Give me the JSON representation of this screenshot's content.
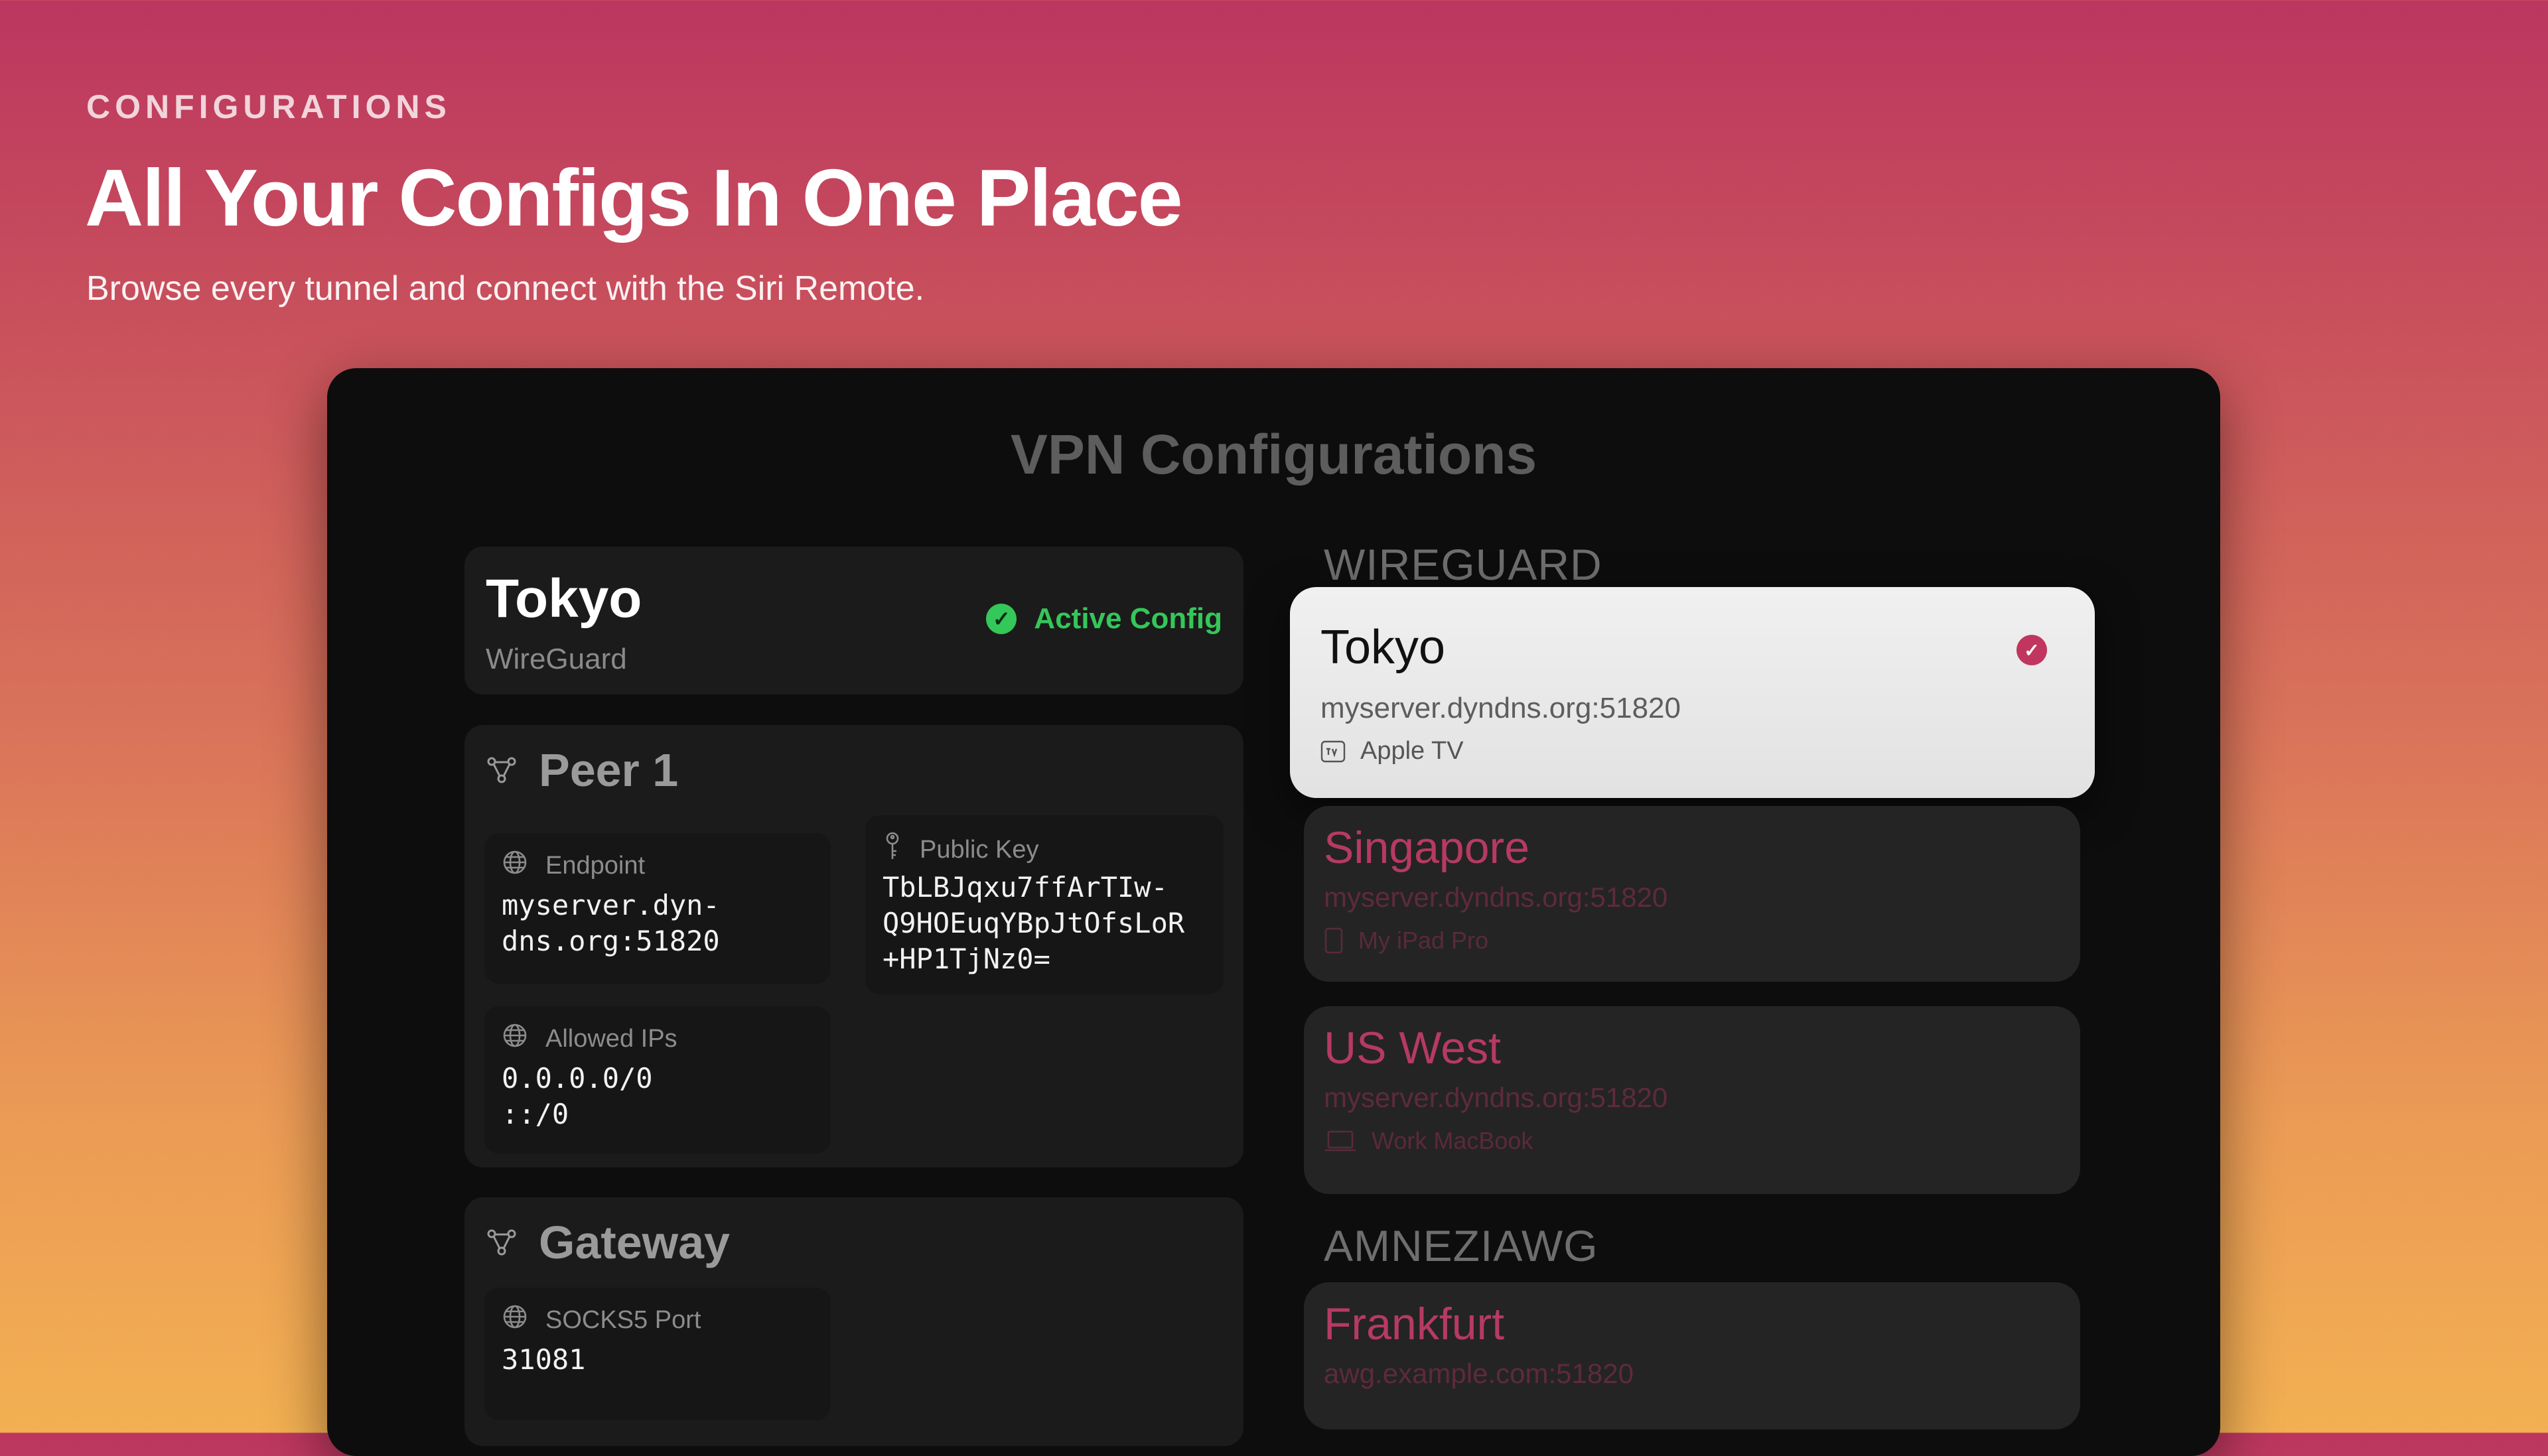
{
  "page": {
    "eyebrow": "CONFIGURATIONS",
    "headline": "All Your Configs In One Place",
    "subline": "Browse every tunnel and connect with the Siri Remote."
  },
  "screen": {
    "title": "VPN Configurations",
    "detail": {
      "name": "Tokyo",
      "protocol": "WireGuard",
      "status_label": "Active Config",
      "peer": {
        "title": "Peer 1",
        "endpoint_label": "Endpoint",
        "endpoint_value": "myserver.dyn-\ndns.org:51820",
        "public_key_label": "Public Key",
        "public_key_value": "TbLBJqxu7ffArTIw-\nQ9HOEuqYBpJtOfsLoR\n+HP1TjNz0=",
        "allowed_ips_label": "Allowed IPs",
        "allowed_ips_value": "0.0.0.0/0\n::/0"
      },
      "gateway": {
        "title": "Gateway",
        "socks_label": "SOCKS5 Port",
        "socks_value": "31081"
      }
    },
    "groups": [
      {
        "label": "WIREGUARD",
        "items": [
          {
            "name": "Tokyo",
            "host": "myserver.dyndns.org:51820",
            "device": "Apple TV",
            "device_icon": "apple-tv-icon",
            "selected": true
          },
          {
            "name": "Singapore",
            "host": "myserver.dyndns.org:51820",
            "device": "My iPad Pro",
            "device_icon": "ipad-icon"
          },
          {
            "name": "US West",
            "host": "myserver.dyndns.org:51820",
            "device": "Work MacBook",
            "device_icon": "laptop-icon"
          }
        ]
      },
      {
        "label": "AMNEZIAWG",
        "items": [
          {
            "name": "Frankfurt",
            "host": "awg.example.com:51820"
          }
        ]
      }
    ]
  },
  "colors": {
    "accent": "#c0365f",
    "active_green": "#34c759"
  }
}
